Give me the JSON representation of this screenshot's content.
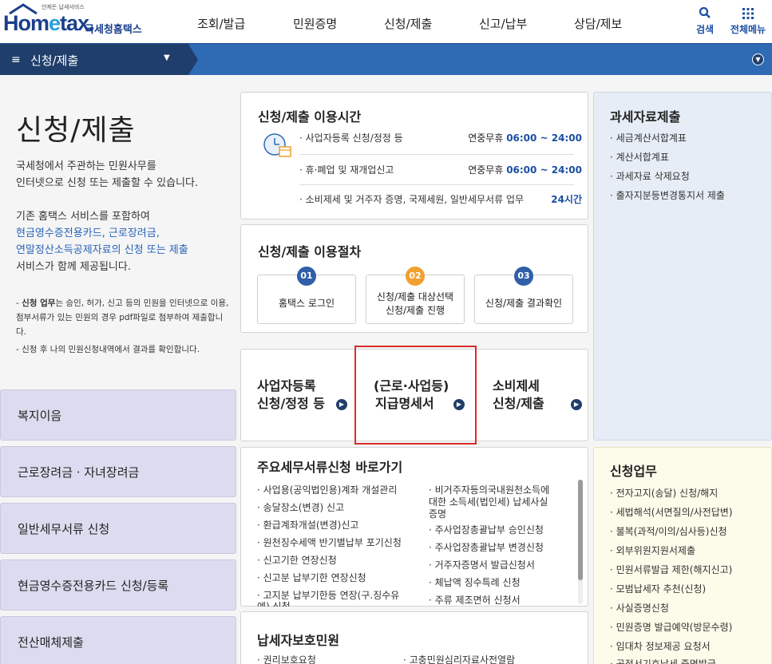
{
  "header": {
    "logo_tagline": "언제든 납세서비스",
    "logo_brand_pre": "Hom",
    "logo_brand_e": "e",
    "logo_brand_post": "tax.",
    "logo_brand_ko": "국세청홈택스",
    "nav": [
      "조회/발급",
      "민원증명",
      "신청/제출",
      "신고/납부",
      "상담/제보"
    ],
    "search_label": "검색",
    "allmenu_label": "전체메뉴"
  },
  "bar": {
    "menu_icon": "≡",
    "selected_menu": "신청/제출",
    "dropdown_icon": "▼",
    "toggle_icon": "▼"
  },
  "intro": {
    "title": "신청/제출",
    "desc1": "국세청에서 주관하는 민원사무를",
    "desc2": "인터넷으로 신청 또는 제출할 수 있습니다.",
    "desc3": "기존 홈택스 서비스를 포함하여",
    "desc4": "현금영수증전용카드, 근로장려금,",
    "desc5": "연말정산소득공제자료의 신청 또는 제출",
    "desc6": "서비스가 함께 제공됩니다.",
    "note1_bold": "신청 업무",
    "note1_rest": "는 승인, 허가, 신고 등의 민원을 인터넷으로 이용, 첨부서류가 있는 민원의 경우 pdf파일로 첨부하여 제출합니다.",
    "note2": "신청 후 나의 민원신청내역에서 결과를 확인합니다."
  },
  "left_menu": [
    "복지이음",
    "근로장려금 · 자녀장려금",
    "일반세무서류 신청",
    "현금영수증전용카드 신청/등록",
    "전산매체제출"
  ],
  "hours": {
    "title": "신청/제출 이용시간",
    "rows": [
      {
        "label": "· 사업자등록 신청/정정 등",
        "prefix": "연중무휴 ",
        "time": "06:00 ~ 24:00"
      },
      {
        "label": "· 휴·폐업 및 재개업신고",
        "prefix": "연중무휴 ",
        "time": "06:00 ~ 24:00"
      },
      {
        "label": "· 소비제세 및 거주자 증명, 국제세원, 일반세무서류 업무",
        "prefix": "",
        "time": "24시간"
      }
    ]
  },
  "procedure": {
    "title": "신청/제출 이용절차",
    "steps": [
      {
        "num": "01",
        "line1": "홈택스 로그인",
        "line2": "",
        "color": "#2f5fa8"
      },
      {
        "num": "02",
        "line1": "신청/제출 대상선택",
        "line2": "신청/제출 진행",
        "color": "#f0a030"
      },
      {
        "num": "03",
        "line1": "신청/제출 결과확인",
        "line2": "",
        "color": "#2f5fa8"
      }
    ]
  },
  "quick": [
    {
      "line1": "사업자등록",
      "line2": "신청/정정 등"
    },
    {
      "line1": "(근로·사업등)",
      "line2": "지급명세서"
    },
    {
      "line1": "소비제세",
      "line2": "신청/제출"
    }
  ],
  "tax_data": {
    "title": "과세자료제출",
    "items": [
      "· 세금계산서합계표",
      "· 계산서합계표",
      "· 과세자료 삭제요청",
      "· 출자지분등변경통지서 제출"
    ]
  },
  "shortcuts": {
    "title": "주요세무서류신청 바로가기",
    "col1": [
      "· 사업용(공익법인용)계좌 개설관리",
      "· 송달장소(변경) 신고",
      "· 환급계좌개설(변경)신고",
      "· 원천징수세액 반기별납부 포기신청",
      "· 신고기한 연장신청",
      "· 신고분 납부기한 연장신청",
      "· 고지분 납부기한등 연장(구.징수유",
      "  예) 신청"
    ],
    "col2_first": [
      "· 비거주자등의국내원천소득에",
      "  대한 소득세(법인세) 납세사실",
      "  증명"
    ],
    "col2": [
      "· 주사업장총괄납부 승인신청",
      "· 주사업장총괄납부 변경신청",
      "· 거주자증명서 발급신청서",
      "· 체납액 징수특례 신청",
      "· 주류 제조면허 신청서"
    ]
  },
  "requests": {
    "title": "신청업무",
    "items": [
      "· 전자고지(송달) 신청/해지",
      "· 세법해석(서면질의/사전답변)",
      "· 불복(과적/이의/심사등)신청",
      "· 외부위원지원서제출",
      "· 민원서류발급 제한(해지신고)",
      "· 모범납세자 추천(신청)",
      "· 사실증명신청",
      "· 민원증명 발급예약(방문수령)",
      "· 임대차 정보제공 요청서",
      "· 공적서기호납세 증명발급"
    ]
  },
  "protection": {
    "title": "납세자보호민원",
    "items": [
      "· 권리보호요청",
      "· 고충민원심리자료사전열람"
    ]
  }
}
